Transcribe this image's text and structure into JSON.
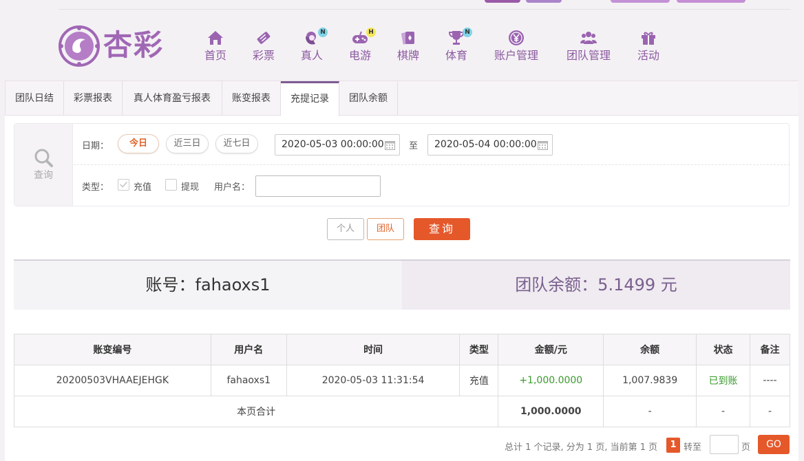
{
  "brand": {
    "name": "杏彩"
  },
  "nav": [
    {
      "label": "首页",
      "icon": "home-icon",
      "badge": ""
    },
    {
      "label": "彩票",
      "icon": "lottery-icon",
      "badge": ""
    },
    {
      "label": "真人",
      "icon": "live-dealer-icon",
      "badge": "N"
    },
    {
      "label": "电游",
      "icon": "gamepad-icon",
      "badge": "H"
    },
    {
      "label": "棋牌",
      "icon": "cards-icon",
      "badge": ""
    },
    {
      "label": "体育",
      "icon": "trophy-icon",
      "badge": "N"
    },
    {
      "label": "账户管理",
      "icon": "yen-icon",
      "badge": ""
    },
    {
      "label": "团队管理",
      "icon": "users-icon",
      "badge": ""
    },
    {
      "label": "活动",
      "icon": "gift-icon",
      "badge": ""
    }
  ],
  "tabs": [
    {
      "label": "团队日结"
    },
    {
      "label": "彩票报表"
    },
    {
      "label": "真人体育盈亏报表"
    },
    {
      "label": "账变报表"
    },
    {
      "label": "充提记录",
      "active": true
    },
    {
      "label": "团队余额"
    }
  ],
  "search": {
    "side_label": "查询",
    "date_label": "日期：",
    "date_options": [
      "今日",
      "近三日",
      "近七日"
    ],
    "start": "2020-05-03 00:00:00",
    "to": "至",
    "end": "2020-05-04 00:00:00",
    "type_label": "类型：",
    "type_deposit": "充值",
    "type_withdraw": "提现",
    "user_label": "用户名：",
    "user_value": ""
  },
  "scope": {
    "personal": "个人",
    "team": "团队",
    "query": "查询"
  },
  "account": {
    "label": "账号：fahaoxs1",
    "team_balance": "团队余额：5.1499 元"
  },
  "table": {
    "headers": [
      "账变编号",
      "用户名",
      "时间",
      "类型",
      "金额/元",
      "余额",
      "状态",
      "备注"
    ],
    "rows": [
      [
        "20200503VHAAEJEHGK",
        "fahaoxs1",
        "2020-05-03 11:31:54",
        "充值",
        "+1,000.0000",
        "1,007.9839",
        "已到账",
        "----"
      ]
    ],
    "subtotal": {
      "label": "本页合计",
      "amount": "1,000.0000",
      "balance": "-",
      "status": "-",
      "remark": "-"
    }
  },
  "pager": {
    "summary": "总计 1 个记录, 分为 1 页, 当前第 1 页",
    "current": "1",
    "goto": "转至",
    "page_unit": "页",
    "go": "GO"
  },
  "colors": {
    "accent": "#e5582a",
    "brand": "#a067b4",
    "success": "#3a9a2c"
  }
}
